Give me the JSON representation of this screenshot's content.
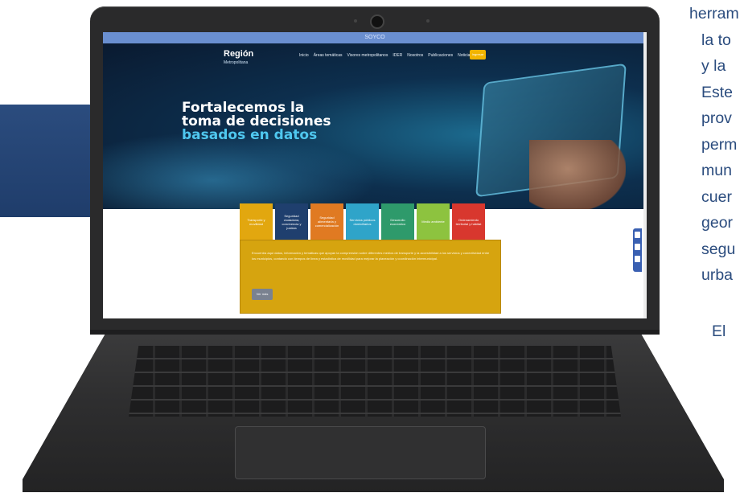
{
  "screen": {
    "top_strip": "SOYCO",
    "logo": {
      "title": "Región",
      "subtitle": "Metropolitana"
    },
    "nav": [
      "Inicio",
      "Áreas temáticas",
      "Visores metropolitanos",
      "IDER",
      "Nosotros",
      "Publicaciones",
      "Noticias"
    ],
    "nav_button": "Ingresar",
    "headline": {
      "line1": "Fortalecemos la",
      "line2": "toma de decisiones",
      "line3": "basados en datos"
    },
    "tabs": [
      {
        "label": "Transporte y movilidad",
        "color": "#e2a70f"
      },
      {
        "label": "Seguridad ciudadana, convivencia y justicia",
        "color": "#1f3f6e"
      },
      {
        "label": "Seguridad alimentaria y comercialización",
        "color": "#e07a22"
      },
      {
        "label": "Servicios públicos domiciliarios",
        "color": "#2fa4c9"
      },
      {
        "label": "Desarrollo económico",
        "color": "#2e9a6b"
      },
      {
        "label": "Medio ambiente",
        "color": "#8dc33f"
      },
      {
        "label": "Ordenamiento territorial y hábitat",
        "color": "#d8372e"
      }
    ],
    "panel_text": "Encuentra aquí datos, información y temáticas que apoyan la comprensión sobre diferentes medios de transporte y la accesibilidad a los servicios y conectividad entre los municipios, contando con tiempos de línea y estadística de movilidad para mejorar la planeación y coordinación intermunicipal.",
    "panel_button": "Ver más",
    "accent_color": "#f2b400"
  },
  "right_text_lines": [
    "herram",
    "la to",
    "y la",
    "Este",
    "prov",
    "perm",
    "mun",
    "cuer",
    "geor",
    "segu",
    "urba",
    "El"
  ]
}
